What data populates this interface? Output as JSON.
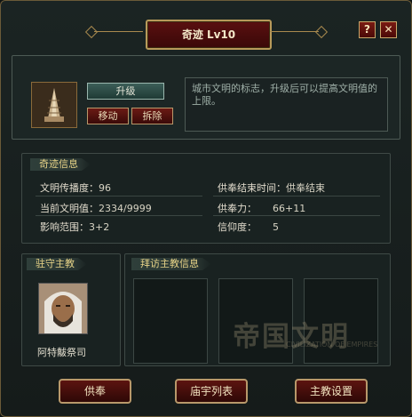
{
  "title": "奇迹 Lv10",
  "header_buttons": {
    "help": "?",
    "close": "✕"
  },
  "building": {
    "icon": "tower-icon",
    "upgrade_label": "升级",
    "move_label": "移动",
    "demolish_label": "拆除",
    "description": "城市文明的标志，升级后可以提高文明值的上限。"
  },
  "info": {
    "heading": "奇迹信息",
    "left": [
      {
        "label": "文明传播度：",
        "value": "96"
      },
      {
        "label": "当前文明值：",
        "value": "2334/9999"
      },
      {
        "label": "影响范围：",
        "value": "3+2"
      }
    ],
    "right": [
      {
        "label": "供奉结束时间：",
        "value": "供奉结束"
      },
      {
        "label": "供奉力：",
        "value": "66+11"
      },
      {
        "label": "信仰度：",
        "value": "5"
      }
    ]
  },
  "garrison": {
    "heading": "驻守主教",
    "name": "阿特黻祭司"
  },
  "visit": {
    "heading": "拜访主教信息"
  },
  "watermark": {
    "text": "帝国文明",
    "sub": "CIVILIZATION OF EMPIRES"
  },
  "footer": {
    "offer": "供奉",
    "temples": "庙宇列表",
    "settings": "主教设置"
  }
}
